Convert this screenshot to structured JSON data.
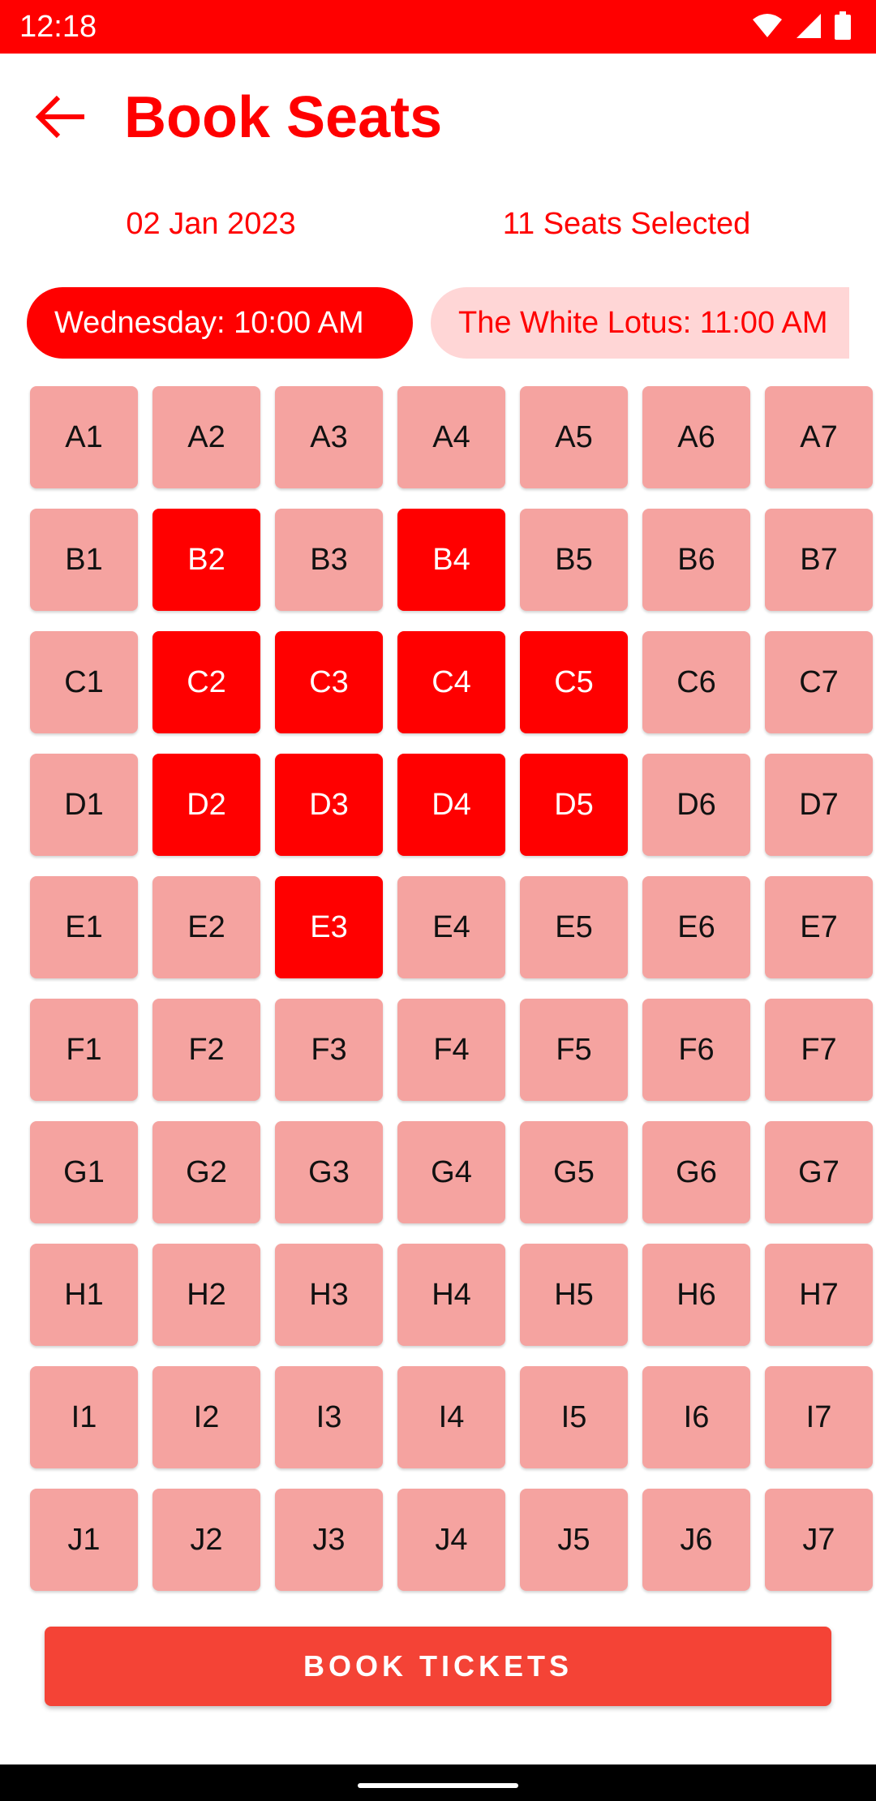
{
  "status_bar": {
    "time": "12:18",
    "icons": [
      "wifi-icon",
      "signal-icon",
      "battery-icon"
    ]
  },
  "app_bar": {
    "back_icon": "arrow-left-icon",
    "title": "Book Seats"
  },
  "info": {
    "date": "02 Jan 2023",
    "seats_selected": "11 Seats Selected"
  },
  "showtimes": [
    {
      "label": "Wednesday: 10:00 AM",
      "active": true
    },
    {
      "label": "The White Lotus: 11:00 AM",
      "active": false
    }
  ],
  "seats": {
    "rows": [
      [
        "A1",
        "A2",
        "A3",
        "A4",
        "A5",
        "A6",
        "A7"
      ],
      [
        "B1",
        "B2",
        "B3",
        "B4",
        "B5",
        "B6",
        "B7"
      ],
      [
        "C1",
        "C2",
        "C3",
        "C4",
        "C5",
        "C6",
        "C7"
      ],
      [
        "D1",
        "D2",
        "D3",
        "D4",
        "D5",
        "D6",
        "D7"
      ],
      [
        "E1",
        "E2",
        "E3",
        "E4",
        "E5",
        "E6",
        "E7"
      ],
      [
        "F1",
        "F2",
        "F3",
        "F4",
        "F5",
        "F6",
        "F7"
      ],
      [
        "G1",
        "G2",
        "G3",
        "G4",
        "G5",
        "G6",
        "G7"
      ],
      [
        "H1",
        "H2",
        "H3",
        "H4",
        "H5",
        "H6",
        "H7"
      ],
      [
        "I1",
        "I2",
        "I3",
        "I4",
        "I5",
        "I6",
        "I7"
      ],
      [
        "J1",
        "J2",
        "J3",
        "J4",
        "J5",
        "J6",
        "J7"
      ]
    ],
    "selected": [
      "B2",
      "B4",
      "C2",
      "C3",
      "C4",
      "C5",
      "D2",
      "D3",
      "D4",
      "D5",
      "E3"
    ]
  },
  "book_button": {
    "label": "BOOK TICKETS"
  },
  "colors": {
    "accent": "#ff0000",
    "seat_available": "#f5a3a0",
    "seat_selected": "#ff0000",
    "chip_inactive_bg": "#ffd6d6",
    "button": "#f44336"
  }
}
